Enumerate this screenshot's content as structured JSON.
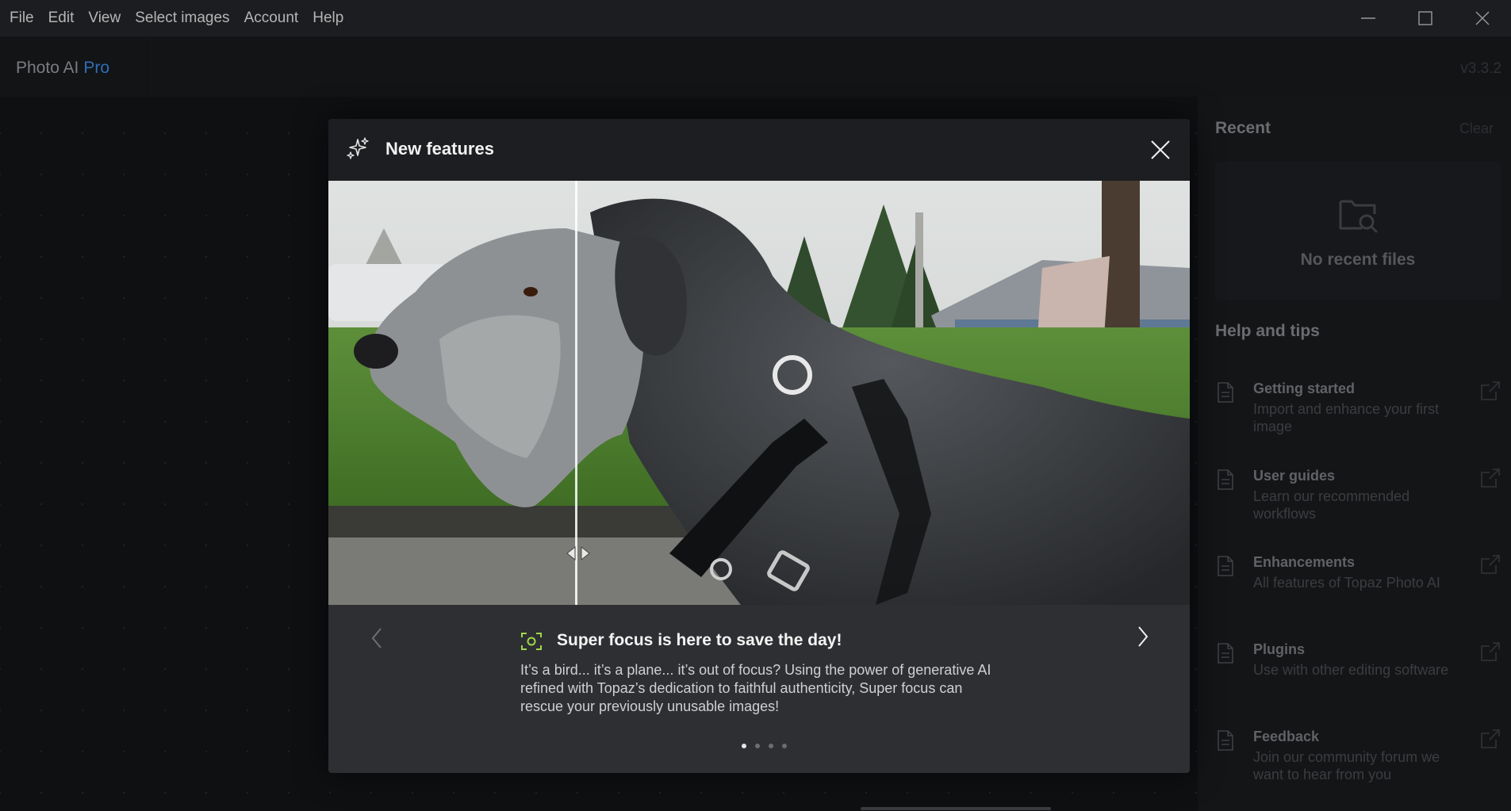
{
  "menu": {
    "items": [
      "File",
      "Edit",
      "View",
      "Select images",
      "Account",
      "Help"
    ]
  },
  "window_controls": [
    "minimize-icon",
    "maximize-icon",
    "close-icon"
  ],
  "app": {
    "name": "Photo AI",
    "tier": "Pro",
    "version": "v3.3.2"
  },
  "right_panel": {
    "recent_title": "Recent",
    "clear_label": "Clear",
    "no_recent": "No recent files",
    "help_title": "Help and tips",
    "tips": [
      {
        "title": "Getting started",
        "desc": "Import and enhance your first image"
      },
      {
        "title": "User guides",
        "desc": "Learn our recommended workflows"
      },
      {
        "title": "Enhancements",
        "desc": "All features of Topaz Photo AI"
      },
      {
        "title": "Plugins",
        "desc": "Use with other editing software"
      },
      {
        "title": "Feedback",
        "desc": "Join our community forum we want to hear from you"
      }
    ]
  },
  "modal": {
    "title": "New features",
    "feature_title": "Super focus is here to save the day!",
    "feature_desc": "It’s a bird... it’s a plane... it’s out of focus? Using the power of generative AI refined with Topaz’s dedication to faithful authenticity, Super focus can rescue your previously unusable images!",
    "page_count": 4,
    "active_page": 1
  },
  "colors": {
    "accent": "#2c6fb8",
    "feature_icon": "#9fd84a",
    "modal_bg": "#2e2f32",
    "header_bg": "#1d1e21"
  }
}
